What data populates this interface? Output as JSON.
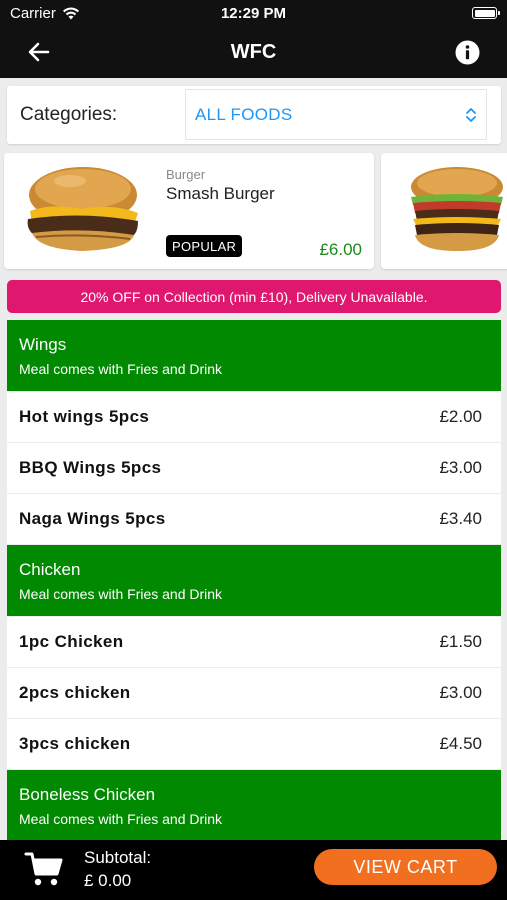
{
  "status_bar": {
    "carrier": "Carrier",
    "time": "12:29 PM"
  },
  "nav": {
    "title": "WFC",
    "back_icon": "arrow-left-icon",
    "info_icon": "info-icon"
  },
  "categories": {
    "label": "Categories:",
    "selected": "ALL FOODS"
  },
  "featured": [
    {
      "category": "Burger",
      "name": "Smash Burger",
      "badge": "POPULAR",
      "price": "£6.00"
    }
  ],
  "promo": {
    "text": "20% OFF on Collection (min £10), Delivery Unavailable."
  },
  "menu": {
    "sections": [
      {
        "title": "Wings",
        "subtitle": "Meal comes with Fries and Drink",
        "items": [
          {
            "name": "Hot wings 5pcs",
            "price": "£2.00"
          },
          {
            "name": "BBQ Wings 5pcs",
            "price": "£3.00"
          },
          {
            "name": "Naga Wings 5pcs",
            "price": "£3.40"
          }
        ]
      },
      {
        "title": "Chicken",
        "subtitle": "Meal comes with Fries and Drink",
        "items": [
          {
            "name": "1pc Chicken",
            "price": "£1.50"
          },
          {
            "name": "2pcs chicken",
            "price": "£3.00"
          },
          {
            "name": "3pcs chicken",
            "price": "£4.50"
          }
        ]
      },
      {
        "title": "Boneless Chicken",
        "subtitle": "Meal comes with Fries and Drink",
        "items": []
      }
    ]
  },
  "bottom_bar": {
    "subtotal_label": "Subtotal:",
    "subtotal_value": "£ 0.00",
    "view_cart_label": "VIEW CART"
  },
  "colors": {
    "accent_blue": "#2196f3",
    "section_green": "#018a01",
    "price_green": "#1c8a1c",
    "promo_pink": "#e0176f",
    "cart_orange": "#f26f1f"
  }
}
